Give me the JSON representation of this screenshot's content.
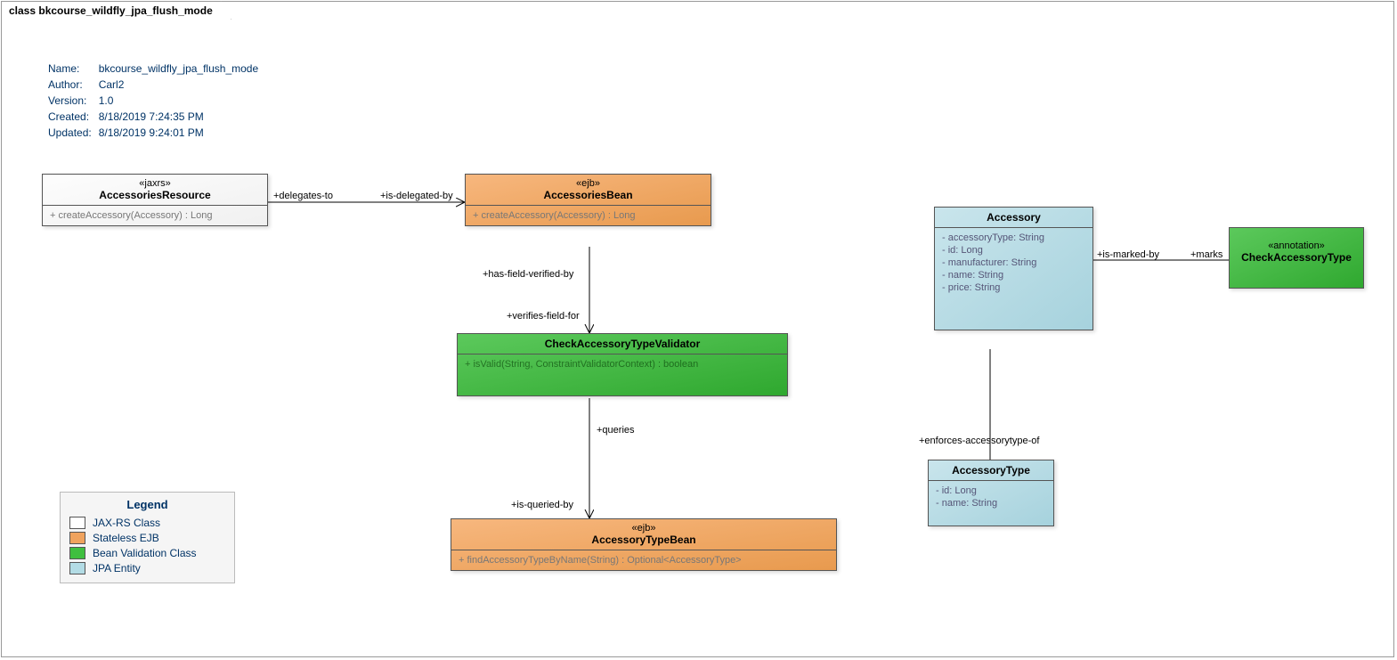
{
  "frame_title": "class bkcourse_wildfly_jpa_flush_mode",
  "meta": {
    "k_name": "Name:",
    "v_name": "bkcourse_wildfly_jpa_flush_mode",
    "k_author": "Author:",
    "v_author": "Carl2",
    "k_version": "Version:",
    "v_version": "1.0",
    "k_created": "Created:",
    "v_created": "8/18/2019 7:24:35 PM",
    "k_updated": "Updated:",
    "v_updated": "8/18/2019 9:24:01 PM"
  },
  "boxes": {
    "accRes": {
      "stereo": "«jaxrs»",
      "name": "AccessoriesResource",
      "op1": "+    createAccessory(Accessory) : Long"
    },
    "accBean": {
      "stereo": "«ejb»",
      "name": "AccessoriesBean",
      "op1": "+    createAccessory(Accessory) : Long"
    },
    "validator": {
      "name": "CheckAccessoryTypeValidator",
      "op1": "+    isValid(String, ConstraintValidatorContext) : boolean"
    },
    "typeBean": {
      "stereo": "«ejb»",
      "name": "AccessoryTypeBean",
      "op1": "+    findAccessoryTypeByName(String) : Optional<AccessoryType>"
    },
    "accessory": {
      "name": "Accessory",
      "a1": "-    accessoryType: String",
      "a2": "-    id: Long",
      "a3": "-    manufacturer: String",
      "a4": "-    name: String",
      "a5": "-    price: String"
    },
    "accessoryType": {
      "name": "AccessoryType",
      "a1": "-    id: Long",
      "a2": "-    name: String"
    },
    "annotation": {
      "stereo": "«annotation»",
      "name": "CheckAccessoryType"
    }
  },
  "labels": {
    "delegates_to": "+delegates-to",
    "is_delegated_by": "+is-delegated-by",
    "has_field_verified_by": "+has-field-verified-by",
    "verifies_field_for": "+verifies-field-for",
    "queries": "+queries",
    "is_queried_by": "+is-queried-by",
    "is_marked_by": "+is-marked-by",
    "marks": "+marks",
    "enforces": "+enforces-accessorytype-of"
  },
  "legend": {
    "title": "Legend",
    "jaxrs": "JAX-RS Class",
    "ejb": "Stateless EJB",
    "validation": "Bean Validation Class",
    "entity": "JPA Entity"
  }
}
